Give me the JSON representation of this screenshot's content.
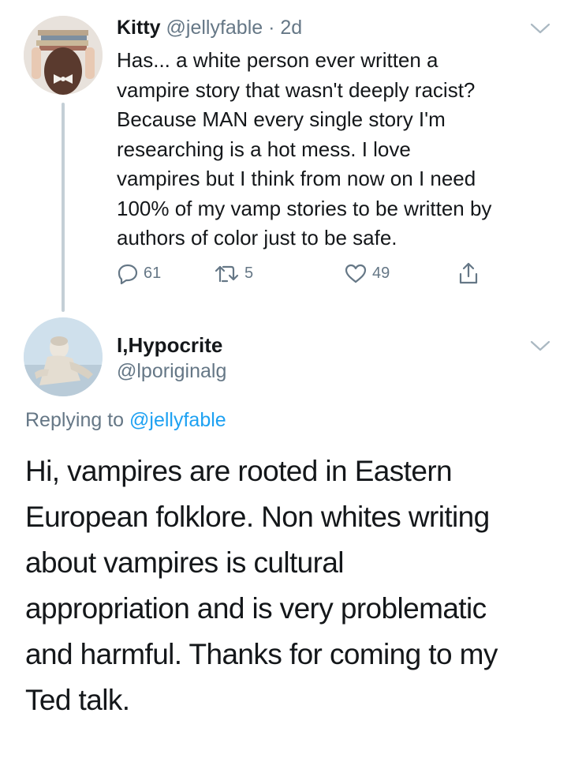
{
  "tweet": {
    "name": "Kitty",
    "handle": "@jellyfable",
    "separator": "·",
    "time": "2d",
    "text": "Has... a white person ever written a\nvampire story that wasn't deeply racist?\nBecause MAN every single story I'm\nresearching is a hot mess. I love\nvampires but I think from now on I need\n100% of my vamp stories to be written by\nauthors of color just to be safe.",
    "reply_count": "61",
    "retweet_count": "5",
    "like_count": "49"
  },
  "reply": {
    "name": "I,Hypocrite",
    "handle": "@lporiginalg",
    "replying_prefix": "Replying to",
    "replying_to": "@jellyfable",
    "text": "Hi, vampires are rooted in Eastern\nEuropean folklore. Non whites writing\nabout vampires is cultural\nappropriation and is very problematic\nand harmful. Thanks for coming to my\nTed talk."
  },
  "icons": {
    "reply": "reply-icon",
    "retweet": "retweet-icon",
    "like": "heart-icon",
    "share": "share-icon",
    "menu": "chevron-down-icon"
  },
  "colors": {
    "text": "#14171a",
    "muted": "#657786",
    "link": "#1da1f2",
    "thread_line": "#c4cfd6"
  }
}
